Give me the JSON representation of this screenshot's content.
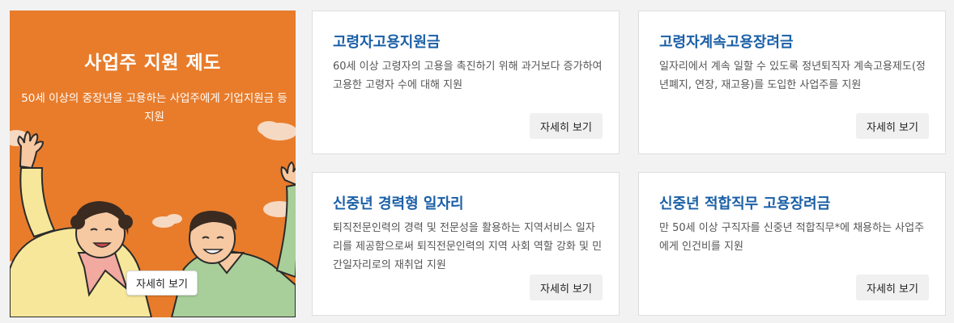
{
  "feature": {
    "title": "사업주 지원 제도",
    "description": "50세 이상의 중장년을 고용하는 사업주에게 기업지원금 등 지원",
    "button_label": "자세히 보기",
    "background": "#e87c2b"
  },
  "cards": [
    {
      "title": "고령자고용지원금",
      "description": "60세 이상 고령자의 고용을 촉진하기 위해 과거보다 증가하여 고용한 고령자 수에 대해 지원",
      "button_label": "자세히 보기"
    },
    {
      "title": "고령자계속고용장려금",
      "description": "일자리에서 계속 일할 수 있도록 정년퇴직자 계속고용제도(정년폐지, 연장, 재고용)를 도입한 사업주를 지원",
      "button_label": "자세히 보기"
    },
    {
      "title": "신중년 경력형 일자리",
      "description": "퇴직전문인력의 경력 및 전문성을 활용하는 지역서비스 일자리를 제공함으로써 퇴직전문인력의 지역 사회 역할 강화 및 민간일자리로의 재취업 지원",
      "button_label": "자세히 보기"
    },
    {
      "title": "신중년 적합직무 고용장려금",
      "description": "만 50세 이상 구직자를 신중년 적합직무*에 채용하는 사업주에게 인건비를 지원",
      "button_label": "자세히 보기"
    }
  ],
  "colors": {
    "card_title": "#1a5fa6",
    "page_background": "#f2f2f2"
  }
}
